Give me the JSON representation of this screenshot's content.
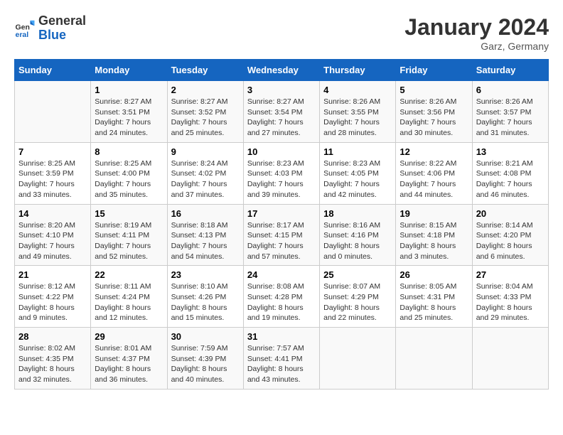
{
  "header": {
    "logo_general": "General",
    "logo_blue": "Blue",
    "month": "January 2024",
    "location": "Garz, Germany"
  },
  "days_of_week": [
    "Sunday",
    "Monday",
    "Tuesday",
    "Wednesday",
    "Thursday",
    "Friday",
    "Saturday"
  ],
  "weeks": [
    [
      {
        "day": "",
        "sunrise": "",
        "sunset": "",
        "daylight": ""
      },
      {
        "day": "1",
        "sunrise": "Sunrise: 8:27 AM",
        "sunset": "Sunset: 3:51 PM",
        "daylight": "Daylight: 7 hours and 24 minutes."
      },
      {
        "day": "2",
        "sunrise": "Sunrise: 8:27 AM",
        "sunset": "Sunset: 3:52 PM",
        "daylight": "Daylight: 7 hours and 25 minutes."
      },
      {
        "day": "3",
        "sunrise": "Sunrise: 8:27 AM",
        "sunset": "Sunset: 3:54 PM",
        "daylight": "Daylight: 7 hours and 27 minutes."
      },
      {
        "day": "4",
        "sunrise": "Sunrise: 8:26 AM",
        "sunset": "Sunset: 3:55 PM",
        "daylight": "Daylight: 7 hours and 28 minutes."
      },
      {
        "day": "5",
        "sunrise": "Sunrise: 8:26 AM",
        "sunset": "Sunset: 3:56 PM",
        "daylight": "Daylight: 7 hours and 30 minutes."
      },
      {
        "day": "6",
        "sunrise": "Sunrise: 8:26 AM",
        "sunset": "Sunset: 3:57 PM",
        "daylight": "Daylight: 7 hours and 31 minutes."
      }
    ],
    [
      {
        "day": "7",
        "sunrise": "Sunrise: 8:25 AM",
        "sunset": "Sunset: 3:59 PM",
        "daylight": "Daylight: 7 hours and 33 minutes."
      },
      {
        "day": "8",
        "sunrise": "Sunrise: 8:25 AM",
        "sunset": "Sunset: 4:00 PM",
        "daylight": "Daylight: 7 hours and 35 minutes."
      },
      {
        "day": "9",
        "sunrise": "Sunrise: 8:24 AM",
        "sunset": "Sunset: 4:02 PM",
        "daylight": "Daylight: 7 hours and 37 minutes."
      },
      {
        "day": "10",
        "sunrise": "Sunrise: 8:23 AM",
        "sunset": "Sunset: 4:03 PM",
        "daylight": "Daylight: 7 hours and 39 minutes."
      },
      {
        "day": "11",
        "sunrise": "Sunrise: 8:23 AM",
        "sunset": "Sunset: 4:05 PM",
        "daylight": "Daylight: 7 hours and 42 minutes."
      },
      {
        "day": "12",
        "sunrise": "Sunrise: 8:22 AM",
        "sunset": "Sunset: 4:06 PM",
        "daylight": "Daylight: 7 hours and 44 minutes."
      },
      {
        "day": "13",
        "sunrise": "Sunrise: 8:21 AM",
        "sunset": "Sunset: 4:08 PM",
        "daylight": "Daylight: 7 hours and 46 minutes."
      }
    ],
    [
      {
        "day": "14",
        "sunrise": "Sunrise: 8:20 AM",
        "sunset": "Sunset: 4:10 PM",
        "daylight": "Daylight: 7 hours and 49 minutes."
      },
      {
        "day": "15",
        "sunrise": "Sunrise: 8:19 AM",
        "sunset": "Sunset: 4:11 PM",
        "daylight": "Daylight: 7 hours and 52 minutes."
      },
      {
        "day": "16",
        "sunrise": "Sunrise: 8:18 AM",
        "sunset": "Sunset: 4:13 PM",
        "daylight": "Daylight: 7 hours and 54 minutes."
      },
      {
        "day": "17",
        "sunrise": "Sunrise: 8:17 AM",
        "sunset": "Sunset: 4:15 PM",
        "daylight": "Daylight: 7 hours and 57 minutes."
      },
      {
        "day": "18",
        "sunrise": "Sunrise: 8:16 AM",
        "sunset": "Sunset: 4:16 PM",
        "daylight": "Daylight: 8 hours and 0 minutes."
      },
      {
        "day": "19",
        "sunrise": "Sunrise: 8:15 AM",
        "sunset": "Sunset: 4:18 PM",
        "daylight": "Daylight: 8 hours and 3 minutes."
      },
      {
        "day": "20",
        "sunrise": "Sunrise: 8:14 AM",
        "sunset": "Sunset: 4:20 PM",
        "daylight": "Daylight: 8 hours and 6 minutes."
      }
    ],
    [
      {
        "day": "21",
        "sunrise": "Sunrise: 8:12 AM",
        "sunset": "Sunset: 4:22 PM",
        "daylight": "Daylight: 8 hours and 9 minutes."
      },
      {
        "day": "22",
        "sunrise": "Sunrise: 8:11 AM",
        "sunset": "Sunset: 4:24 PM",
        "daylight": "Daylight: 8 hours and 12 minutes."
      },
      {
        "day": "23",
        "sunrise": "Sunrise: 8:10 AM",
        "sunset": "Sunset: 4:26 PM",
        "daylight": "Daylight: 8 hours and 15 minutes."
      },
      {
        "day": "24",
        "sunrise": "Sunrise: 8:08 AM",
        "sunset": "Sunset: 4:28 PM",
        "daylight": "Daylight: 8 hours and 19 minutes."
      },
      {
        "day": "25",
        "sunrise": "Sunrise: 8:07 AM",
        "sunset": "Sunset: 4:29 PM",
        "daylight": "Daylight: 8 hours and 22 minutes."
      },
      {
        "day": "26",
        "sunrise": "Sunrise: 8:05 AM",
        "sunset": "Sunset: 4:31 PM",
        "daylight": "Daylight: 8 hours and 25 minutes."
      },
      {
        "day": "27",
        "sunrise": "Sunrise: 8:04 AM",
        "sunset": "Sunset: 4:33 PM",
        "daylight": "Daylight: 8 hours and 29 minutes."
      }
    ],
    [
      {
        "day": "28",
        "sunrise": "Sunrise: 8:02 AM",
        "sunset": "Sunset: 4:35 PM",
        "daylight": "Daylight: 8 hours and 32 minutes."
      },
      {
        "day": "29",
        "sunrise": "Sunrise: 8:01 AM",
        "sunset": "Sunset: 4:37 PM",
        "daylight": "Daylight: 8 hours and 36 minutes."
      },
      {
        "day": "30",
        "sunrise": "Sunrise: 7:59 AM",
        "sunset": "Sunset: 4:39 PM",
        "daylight": "Daylight: 8 hours and 40 minutes."
      },
      {
        "day": "31",
        "sunrise": "Sunrise: 7:57 AM",
        "sunset": "Sunset: 4:41 PM",
        "daylight": "Daylight: 8 hours and 43 minutes."
      },
      {
        "day": "",
        "sunrise": "",
        "sunset": "",
        "daylight": ""
      },
      {
        "day": "",
        "sunrise": "",
        "sunset": "",
        "daylight": ""
      },
      {
        "day": "",
        "sunrise": "",
        "sunset": "",
        "daylight": ""
      }
    ]
  ]
}
